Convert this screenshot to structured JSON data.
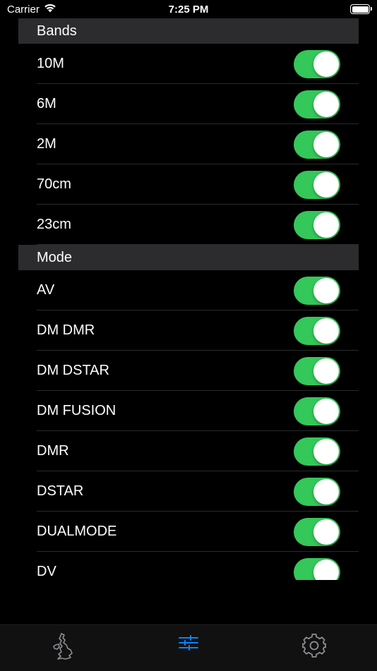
{
  "status_bar": {
    "carrier": "Carrier",
    "time": "7:25 PM",
    "battery_level": 1.0
  },
  "sections": [
    {
      "title": "Bands",
      "items": [
        {
          "label": "10M",
          "on": true
        },
        {
          "label": "6M",
          "on": true
        },
        {
          "label": "2M",
          "on": true
        },
        {
          "label": "70cm",
          "on": true
        },
        {
          "label": "23cm",
          "on": true
        }
      ]
    },
    {
      "title": "Mode",
      "items": [
        {
          "label": "AV",
          "on": true
        },
        {
          "label": "DM DMR",
          "on": true
        },
        {
          "label": "DM DSTAR",
          "on": true
        },
        {
          "label": "DM FUSION",
          "on": true
        },
        {
          "label": "DMR",
          "on": true
        },
        {
          "label": "DSTAR",
          "on": true
        },
        {
          "label": "DUALMODE",
          "on": true
        },
        {
          "label": "DV",
          "on": true
        }
      ]
    }
  ],
  "tabs": [
    {
      "icon": "uk-map-icon",
      "selected": false
    },
    {
      "icon": "sliders-icon",
      "selected": true
    },
    {
      "icon": "gear-icon",
      "selected": false
    }
  ],
  "colors": {
    "toggle_on": "#34c759",
    "tab_selected": "#0a84ff",
    "tab_unselected": "#8e8e93",
    "section_header_bg": "#2c2c2e"
  }
}
